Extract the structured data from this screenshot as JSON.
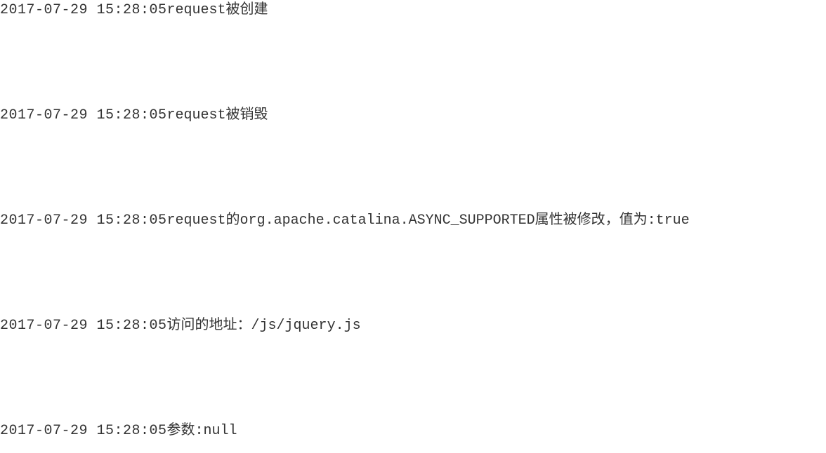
{
  "log_entries": [
    {
      "timestamp": "2017-07-29 15:28:05",
      "message": "request被创建"
    },
    {
      "timestamp": "2017-07-29 15:28:05",
      "message": "request被销毁"
    },
    {
      "timestamp": "2017-07-29 15:28:05",
      "message": "request的org.apache.catalina.ASYNC_SUPPORTED属性被修改，值为:true"
    },
    {
      "timestamp": "2017-07-29 15:28:05",
      "message": "访问的地址：/js/jquery.js"
    },
    {
      "timestamp": "2017-07-29 15:28:05",
      "message": "参数:null"
    }
  ]
}
